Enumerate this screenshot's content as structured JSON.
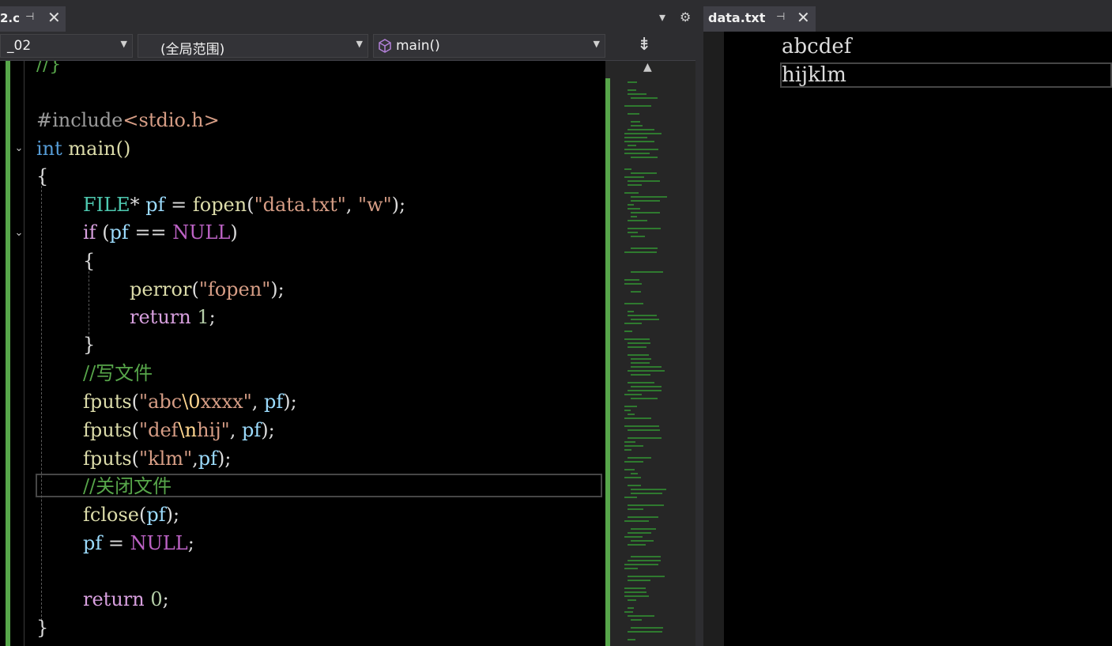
{
  "left_tab": {
    "title": "2.c",
    "pin_icon": "pin-icon",
    "close_icon": "close-icon"
  },
  "header_icons": {
    "dropdown": "▾",
    "settings": "⚙"
  },
  "navbar": {
    "project": "_02",
    "scope": "(全局范围)",
    "function": "main()"
  },
  "code_lines": [
    {
      "text": "//}"
    },
    {
      "text": ""
    },
    {
      "text": "#include<stdio.h>"
    },
    {
      "text": "int main()"
    },
    {
      "text": "{"
    },
    {
      "text": "FILE* pf = fopen(\"data.txt\", \"w\");"
    },
    {
      "text": "if (pf == NULL)"
    },
    {
      "text": "{"
    },
    {
      "text": "perror(\"fopen\");"
    },
    {
      "text": "return 1;"
    },
    {
      "text": "}"
    },
    {
      "text": "//写文件"
    },
    {
      "text": "fputs(\"abc\\0xxxx\", pf);"
    },
    {
      "text": "fputs(\"def\\nhij\", pf);"
    },
    {
      "text": "fputs(\"klm\",pf);"
    },
    {
      "text": "//关闭文件"
    },
    {
      "text": "fclose(pf);"
    },
    {
      "text": "pf = NULL;"
    },
    {
      "text": ""
    },
    {
      "text": "return 0;"
    },
    {
      "text": "}"
    }
  ],
  "tokens": {
    "l0": "//}",
    "l2_a": "#include",
    "l2_b": "<stdio.h>",
    "l3_a": "int",
    "l3_b": " main()",
    "l4": "{",
    "l5_a": "FILE",
    "l5_b": "* ",
    "l5_c": "pf",
    "l5_d": " = ",
    "l5_e": "fopen",
    "l5_f": "(",
    "l5_g": "\"data.txt\"",
    "l5_h": ", ",
    "l5_i": "\"w\"",
    "l5_j": ");",
    "l6_a": "if",
    "l6_b": " (",
    "l6_c": "pf",
    "l6_d": " == ",
    "l6_e": "NULL",
    "l6_f": ")",
    "l7": "{",
    "l8_a": "perror",
    "l8_b": "(",
    "l8_c": "\"fopen\"",
    "l8_d": ");",
    "l9_a": "return",
    "l9_b": " ",
    "l9_c": "1",
    "l9_d": ";",
    "l10": "}",
    "l11": "//写文件",
    "l12_a": "fputs",
    "l12_b": "(",
    "l12_c": "\"abc",
    "l12_d": "\\0",
    "l12_e": "xxxx\"",
    "l12_f": ", ",
    "l12_g": "pf",
    "l12_h": ");",
    "l13_a": "fputs",
    "l13_b": "(",
    "l13_c": "\"def",
    "l13_d": "\\n",
    "l13_e": "hij\"",
    "l13_f": ", ",
    "l13_g": "pf",
    "l13_h": ");",
    "l14_a": "fputs",
    "l14_b": "(",
    "l14_c": "\"klm\"",
    "l14_d": ",",
    "l14_e": "pf",
    "l14_f": ");",
    "l15": "//关闭文件",
    "l16_a": "fclose",
    "l16_b": "(",
    "l16_c": "pf",
    "l16_d": ");",
    "l17_a": "pf",
    "l17_b": " = ",
    "l17_c": "NULL",
    "l17_d": ";",
    "l19_a": "return",
    "l19_b": " ",
    "l19_c": "0",
    "l19_d": ";",
    "l20": "}"
  },
  "right_tab": {
    "title": "data.txt",
    "pin_icon": "pin-icon",
    "close_icon": "close-icon"
  },
  "data_txt_lines": [
    "abcdef",
    "hijklm"
  ],
  "colors": {
    "keyword": "#569cd6",
    "control": "#d8a0df",
    "type": "#4ec9b0",
    "function": "#dcdcaa",
    "string": "#d69d85",
    "number": "#b5cea8",
    "variable": "#9cdcfe",
    "comment": "#57a64a",
    "background": "#000000",
    "change_bar": "#57a64a"
  }
}
